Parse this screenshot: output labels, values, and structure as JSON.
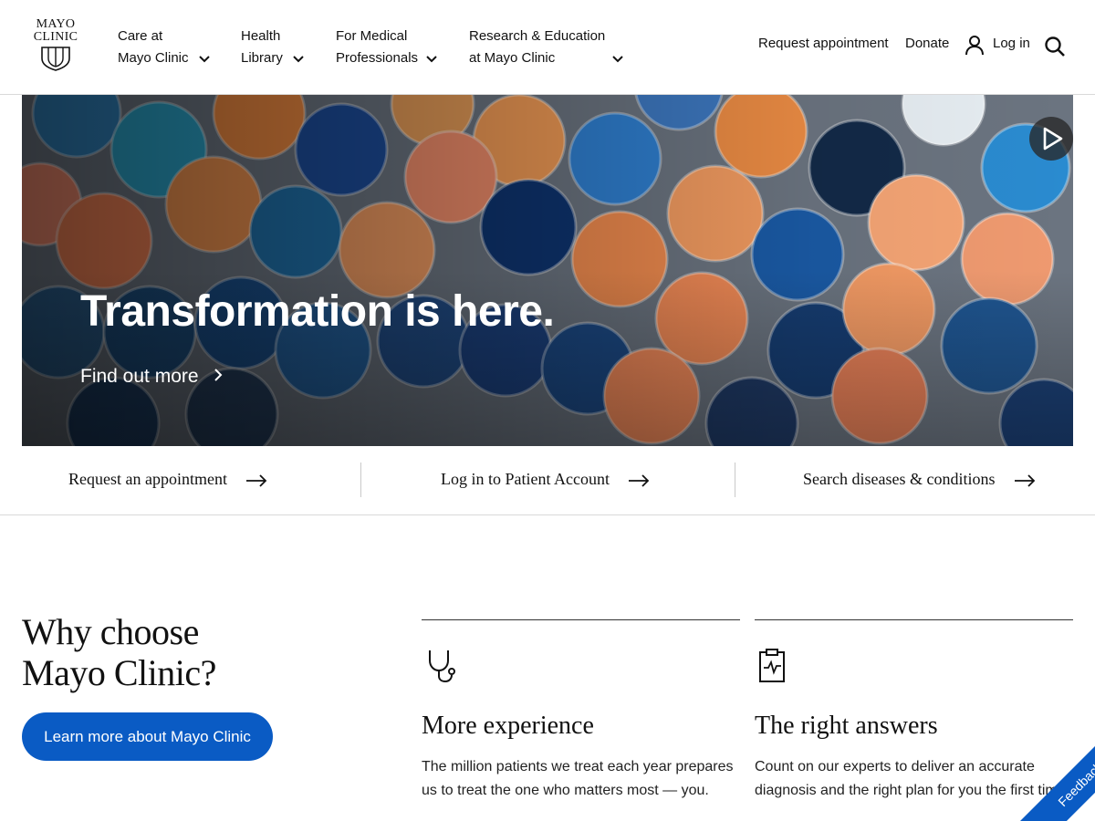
{
  "header": {
    "logo": {
      "line1": "MAYO",
      "line2": "CLINIC"
    },
    "nav": [
      {
        "line1": "Care at",
        "line2": "Mayo Clinic"
      },
      {
        "line1": "Health",
        "line2": "Library"
      },
      {
        "line1": "For Medical",
        "line2": "Professionals"
      },
      {
        "line1": "Research & Education",
        "line2": "at Mayo Clinic"
      }
    ],
    "utility": {
      "request": "Request appointment",
      "donate": "Donate",
      "login": "Log in"
    }
  },
  "hero": {
    "title": "Transformation is here.",
    "link": "Find out more"
  },
  "quick_links": [
    "Request an appointment",
    "Log in to Patient Account",
    "Search diseases & conditions"
  ],
  "why": {
    "title_line1": "Why choose",
    "title_line2": "Mayo Clinic?",
    "button": "Learn more about Mayo Clinic",
    "features": [
      {
        "icon": "stethoscope-icon",
        "title": "More experience",
        "text": "The million patients we treat each year prepares us to treat the one who matters most — you."
      },
      {
        "icon": "clipboard-heartbeat-icon",
        "title": "The right answers",
        "text": "Count on our experts to deliver an accurate diagnosis and the right plan for you the first time."
      }
    ]
  },
  "feedback": "Feedback",
  "colors": {
    "brand_blue": "#0a5bc4",
    "text": "#111111",
    "divider": "#d9d9d9"
  }
}
